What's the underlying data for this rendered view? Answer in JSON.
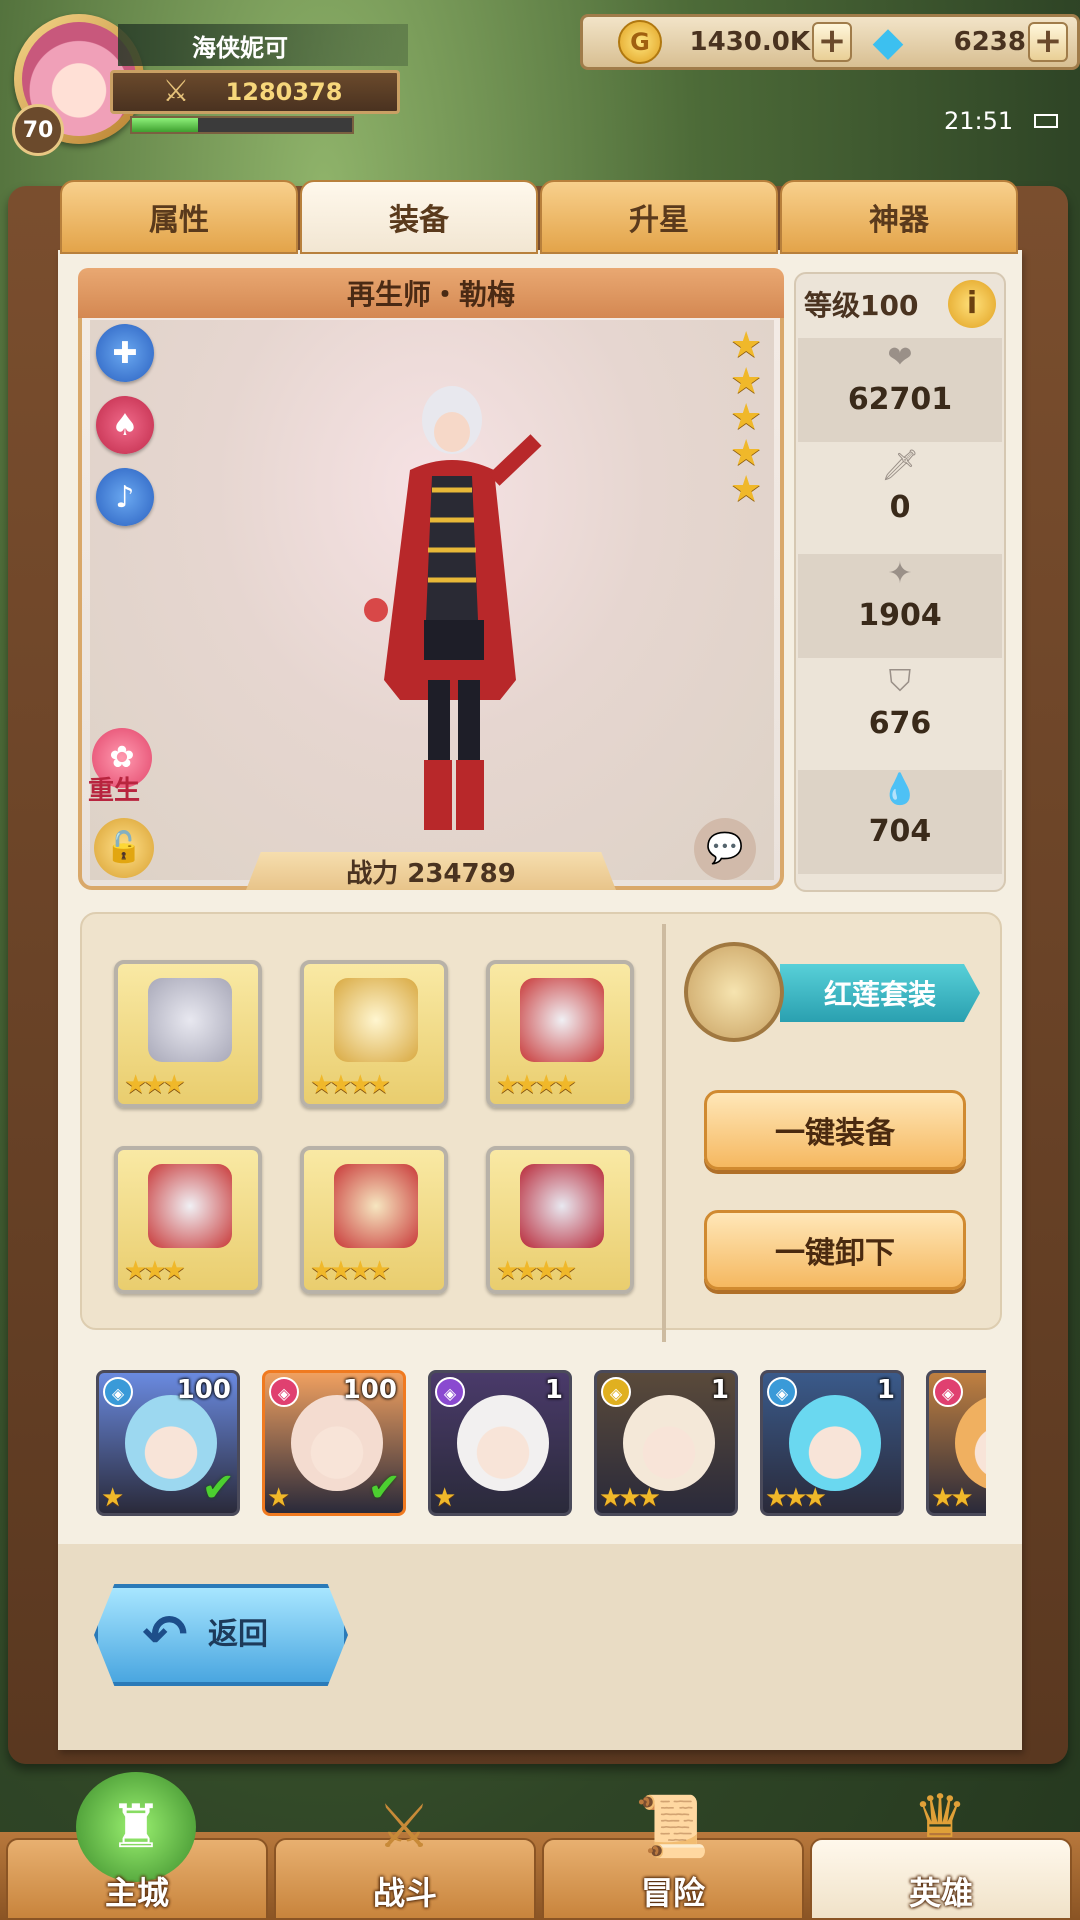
{
  "player": {
    "name": "海侠妮可",
    "level": "70",
    "power": "1280378",
    "exp_fraction": 0.3
  },
  "currency": {
    "gold": "1430.0K",
    "gems": "6238"
  },
  "status": {
    "time": "21:51"
  },
  "tabs": [
    "属性",
    "装备",
    "升星",
    "神器"
  ],
  "active_tab": "装备",
  "hero": {
    "title": "再生师・勒梅",
    "stars": 5,
    "rebirth_label": "重生",
    "battle_power": "战力 234789",
    "level_label": "等级100"
  },
  "stats": {
    "hp": "62701",
    "attack": "0",
    "magic": "1904",
    "armor": "676",
    "resist": "704"
  },
  "equipment": {
    "set_name": "红莲套装",
    "equip_all": "一键装备",
    "unequip_all": "一键卸下",
    "slots": [
      {
        "name": "helmet",
        "stars": "★★★"
      },
      {
        "name": "weapon",
        "stars": "★★★★"
      },
      {
        "name": "armor",
        "stars": "★★★★"
      },
      {
        "name": "gauntlets",
        "stars": "★★★"
      },
      {
        "name": "boots",
        "stars": "★★★★"
      },
      {
        "name": "accessory",
        "stars": "★★★★"
      }
    ]
  },
  "roster": [
    {
      "level": "100",
      "stars": "★",
      "equipped": "✔",
      "color": "#6a8ae0",
      "type_color": "#3a9ad8",
      "face": "#9cd8f0"
    },
    {
      "level": "100",
      "stars": "★",
      "equipped": "✔",
      "color": "#f0a060",
      "type_color": "#e04070",
      "face": "#f4dcd0"
    },
    {
      "level": "1",
      "stars": "★",
      "equipped": "",
      "color": "#4a3a6a",
      "type_color": "#8a4ad0",
      "face": "#f2f0f0"
    },
    {
      "level": "1",
      "stars": "★★★",
      "equipped": "",
      "color": "#5a4a3a",
      "type_color": "#e0b020",
      "face": "#f4e8d8"
    },
    {
      "level": "1",
      "stars": "★★★",
      "equipped": "",
      "color": "#3a5a8a",
      "type_color": "#3a9ad8",
      "face": "#6ad8f0"
    },
    {
      "level": "",
      "stars": "★★",
      "equipped": "",
      "color": "#c08040",
      "type_color": "#e04070",
      "face": "#f0b060"
    }
  ],
  "back_label": "返回",
  "nav": [
    {
      "label": "主城",
      "icon": "castle-icon"
    },
    {
      "label": "战斗",
      "icon": "crossed-swords-icon"
    },
    {
      "label": "冒险",
      "icon": "map-scroll-icon"
    },
    {
      "label": "英雄",
      "icon": "hero-emblem-icon"
    }
  ],
  "active_nav": "英雄"
}
